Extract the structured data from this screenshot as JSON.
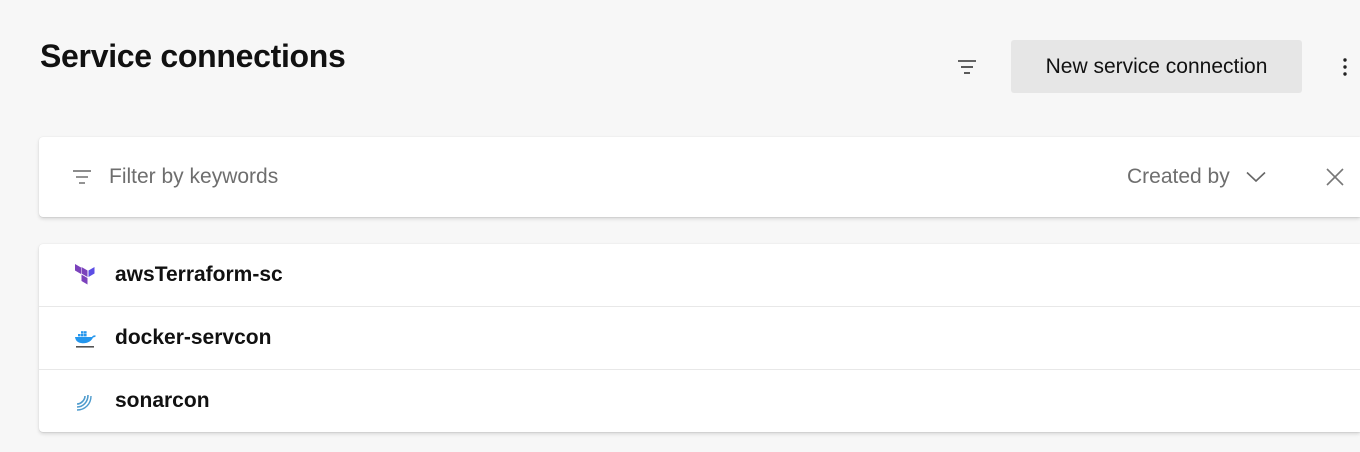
{
  "header": {
    "title": "Service connections",
    "filter_icon": "filter-icon",
    "new_button_label": "New service connection",
    "more_icon": "more-vertical-icon"
  },
  "filter_bar": {
    "icon": "filter-icon",
    "placeholder": "Filter by keywords",
    "value": "",
    "created_by_label": "Created by",
    "created_by_icon": "chevron-down-icon",
    "clear_icon": "close-icon"
  },
  "connections": [
    {
      "name": "awsTerraform-sc",
      "icon": "terraform-icon",
      "icon_color": "#7b42bc"
    },
    {
      "name": "docker-servcon",
      "icon": "docker-icon",
      "icon_color": "#2496ed"
    },
    {
      "name": "sonarcon",
      "icon": "sonarqube-icon",
      "icon_color": "#4e9bcd"
    }
  ]
}
